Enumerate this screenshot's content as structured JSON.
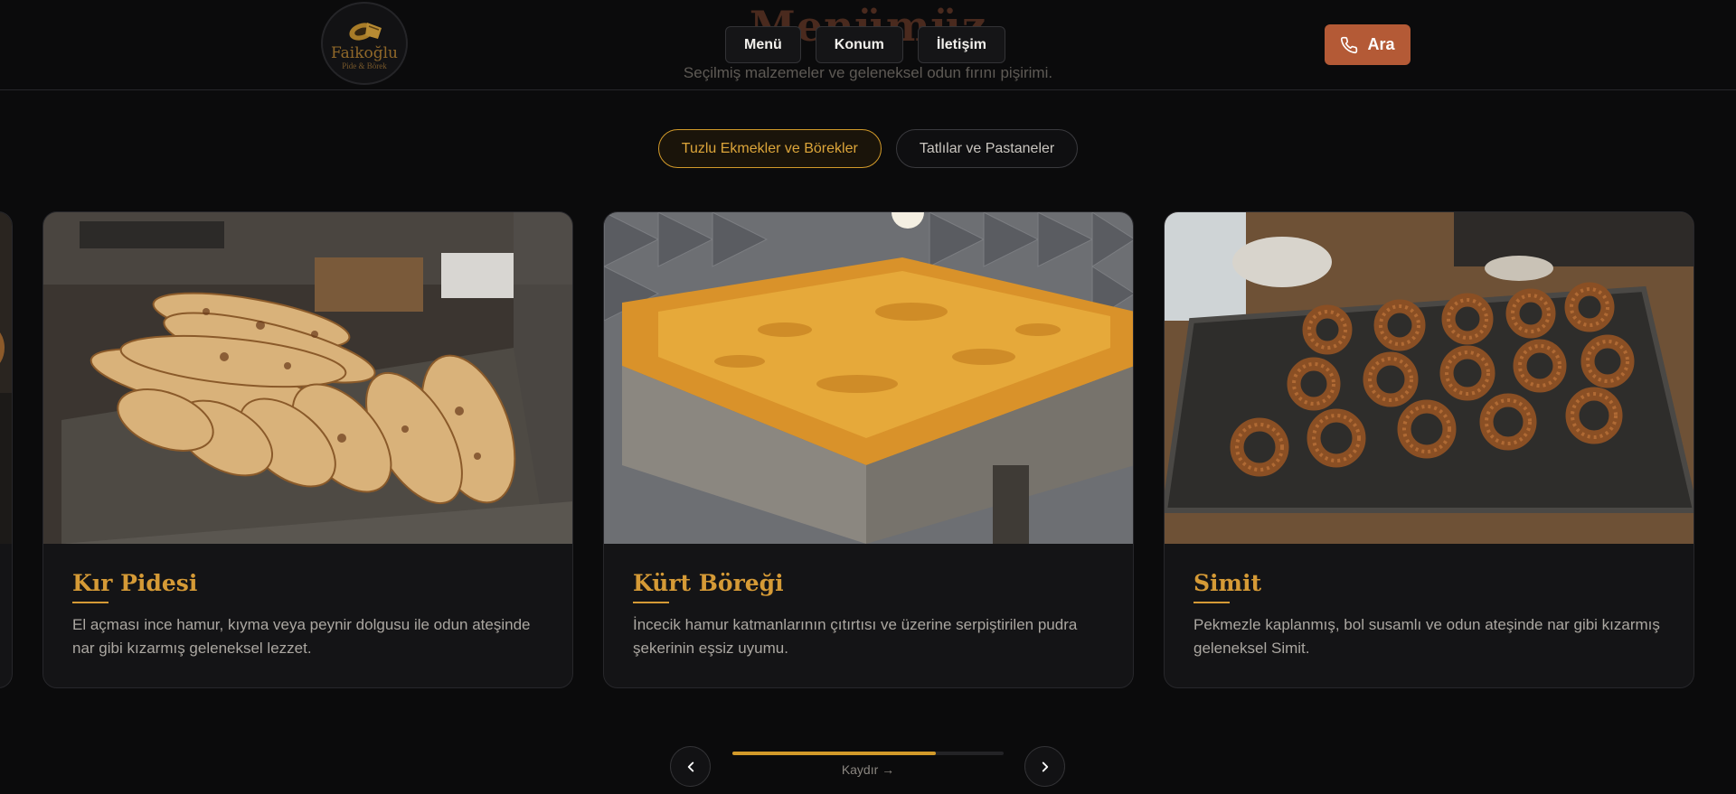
{
  "header": {
    "logo_name": "Faikoğlu",
    "logo_sub": "Pide & Börek",
    "section_title": "Menümüz",
    "section_subtitle": "Seçilmiş malzemeler ve geleneksel odun fırını pişirimi.",
    "nav": [
      {
        "label": "Menü"
      },
      {
        "label": "Konum"
      },
      {
        "label": "İletişim"
      }
    ],
    "call_label": "Ara",
    "call_icon": "phone-icon"
  },
  "tabs": [
    {
      "label": "Tuzlu Ekmekler ve Börekler",
      "active": true
    },
    {
      "label": "Tatlılar ve Pastaneler",
      "active": false
    }
  ],
  "cards": [
    {
      "title": "Kır Pidesi",
      "description": "El açması ince hamur, kıyma veya peynir dolgusu ile odun ateşinde nar gibi kızarmış geleneksel lezzet."
    },
    {
      "title": "Kürt Böreği",
      "description": "İncecik hamur katmanlarının çıtırtısı ve üzerine serpiştirilen pudra şekerinin eşsiz uyumu."
    },
    {
      "title": "Simit",
      "description": "Pekmezle kaplanmış, bol susamlı ve odun ateşinde nar gibi kızarmış geleneksel Simit."
    }
  ],
  "carousel": {
    "scroll_label": "Kaydır →",
    "progress": 0.75
  },
  "colors": {
    "accent": "#d29a2a",
    "call_button": "#b45a36",
    "background": "#0b0b0c"
  }
}
